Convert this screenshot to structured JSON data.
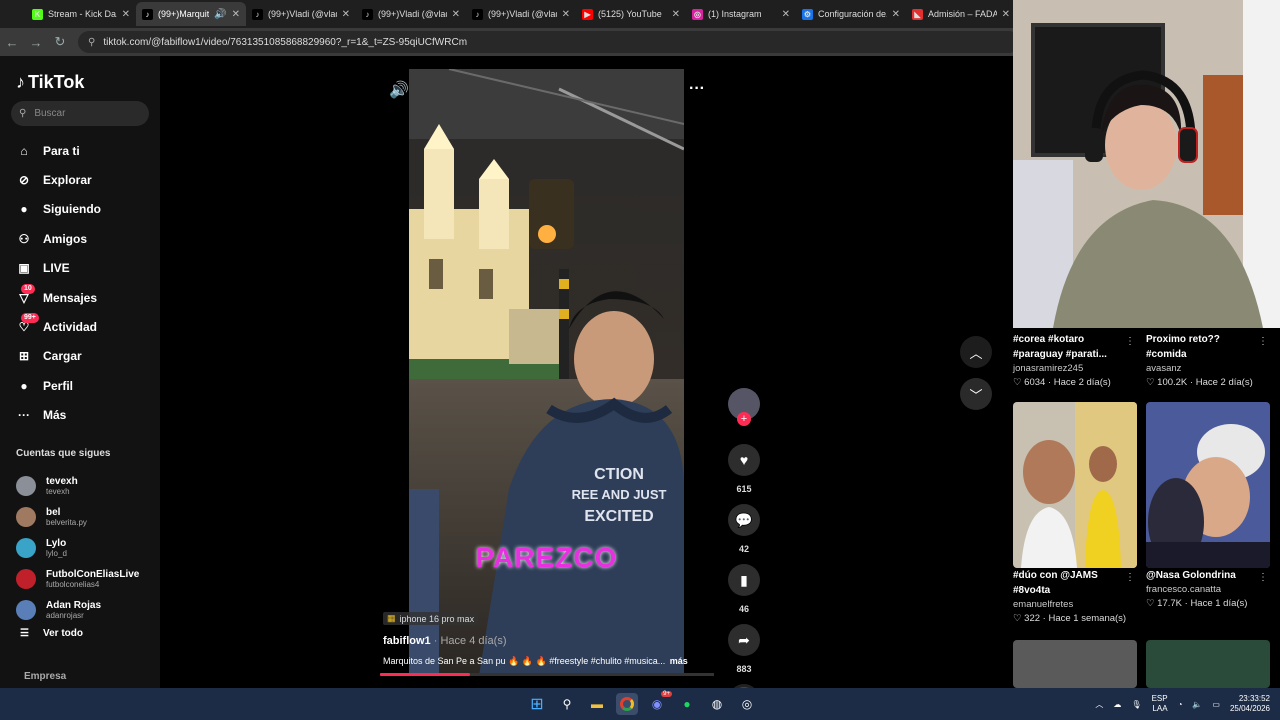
{
  "browser": {
    "tabs": [
      {
        "title": "Stream - Kick Da...",
        "fav_color": "#53fc18",
        "fav_glyph": "K",
        "active": false
      },
      {
        "title": "(99+)Marquitos",
        "fav_color": "#000000",
        "fav_glyph": "♪",
        "active": true
      },
      {
        "title": "(99+)Vladi (@vlad...",
        "fav_color": "#000000",
        "fav_glyph": "♪",
        "active": false
      },
      {
        "title": "(99+)Vladi (@vlad...",
        "fav_color": "#000000",
        "fav_glyph": "♪",
        "active": false
      },
      {
        "title": "(99+)Vladi (@vlad...",
        "fav_color": "#000000",
        "fav_glyph": "♪",
        "active": false
      },
      {
        "title": "(5125) YouTube",
        "fav_color": "#ff0000",
        "fav_glyph": "▶",
        "active": false
      },
      {
        "title": "(1) Instagram",
        "fav_color": "#d6249f",
        "fav_glyph": "◎",
        "active": false
      },
      {
        "title": "Configuración de...",
        "fav_color": "#1a73e8",
        "fav_glyph": "⚙",
        "active": false
      },
      {
        "title": "Admisión – FADA",
        "fav_color": "#e03030",
        "fav_glyph": "◣",
        "active": false
      }
    ],
    "url": "tiktok.com/@fabiflow1/video/7631351085868829960?_r=1&_t=ZS-95qiUCfWRCm"
  },
  "sidebar": {
    "logo": "TikTok",
    "search_placeholder": "Buscar",
    "nav": [
      {
        "label": "Para ti",
        "icon": "home-icon",
        "glyph": "⌂",
        "badge": ""
      },
      {
        "label": "Explorar",
        "icon": "compass-icon",
        "glyph": "⊘",
        "badge": ""
      },
      {
        "label": "Siguiendo",
        "icon": "following-avatar-icon",
        "glyph": "●",
        "badge": ""
      },
      {
        "label": "Amigos",
        "icon": "friends-icon",
        "glyph": "⚇",
        "badge": ""
      },
      {
        "label": "LIVE",
        "icon": "live-tv-icon",
        "glyph": "▣",
        "badge": ""
      },
      {
        "label": "Mensajes",
        "icon": "messages-icon",
        "glyph": "▽",
        "badge": "10"
      },
      {
        "label": "Actividad",
        "icon": "activity-icon",
        "glyph": "♡",
        "badge": "99+"
      },
      {
        "label": "Cargar",
        "icon": "upload-icon",
        "glyph": "⊞",
        "badge": ""
      },
      {
        "label": "Perfil",
        "icon": "profile-avatar-icon",
        "glyph": "●",
        "badge": ""
      },
      {
        "label": "Más",
        "icon": "more-icon",
        "glyph": "···",
        "badge": ""
      }
    ],
    "following_title": "Cuentas que sigues",
    "following": [
      {
        "name": "tevexh",
        "handle": "tevexh",
        "color": "#8a8f98"
      },
      {
        "name": "bel",
        "handle": "belverita.py",
        "color": "#a07a60"
      },
      {
        "name": "Lylo",
        "handle": "lylo_d",
        "color": "#3aa3c8"
      },
      {
        "name": "FutbolConEliasLive",
        "handle": "futbolconelias4",
        "color": "#c0202a"
      },
      {
        "name": "Adan Rojas",
        "handle": "adanrojasr",
        "color": "#5a7fb8"
      }
    ],
    "see_all": "Ver todo",
    "company": "Empresa"
  },
  "video": {
    "overlay_text": "PAREZCO",
    "shirt_text": "ACTION FREE AND JUST EXCITED",
    "device_tag": "iphone 16 pro max",
    "author": "fabiflow1",
    "posted": "· Hace 4 día(s)",
    "caption": "Marquitos de San Pe a San pu 🔥 🔥 🔥 #freestyle #chulito #musica...",
    "more": "más",
    "progress": 0.27
  },
  "actions": {
    "likes": "615",
    "comments": "42",
    "saves": "46",
    "shares": "883"
  },
  "recommended": [
    {
      "title": "#corea #kotaro #paraguay #parati...",
      "user": "jonasramirez245",
      "likes": "6034",
      "time": "Hace 2 día(s)"
    },
    {
      "title": "Proximo reto?? #comida",
      "user": "avasanz",
      "likes": "100.2K",
      "time": "Hace 2 día(s)"
    },
    {
      "title": "#dúo con @JAMS #8vo4ta",
      "user": "emanuelfretes",
      "likes": "322",
      "time": "Hace 1 semana(s)"
    },
    {
      "title": "@Nasa Golondrina",
      "user": "francesco.canatta",
      "likes": "17.7K",
      "time": "Hace 1 día(s)"
    }
  ],
  "taskbar": {
    "lang": "ESP",
    "lang2": "LAA",
    "time": "23:33:52",
    "date": "25/04/2026",
    "discord_badge": "9+"
  }
}
